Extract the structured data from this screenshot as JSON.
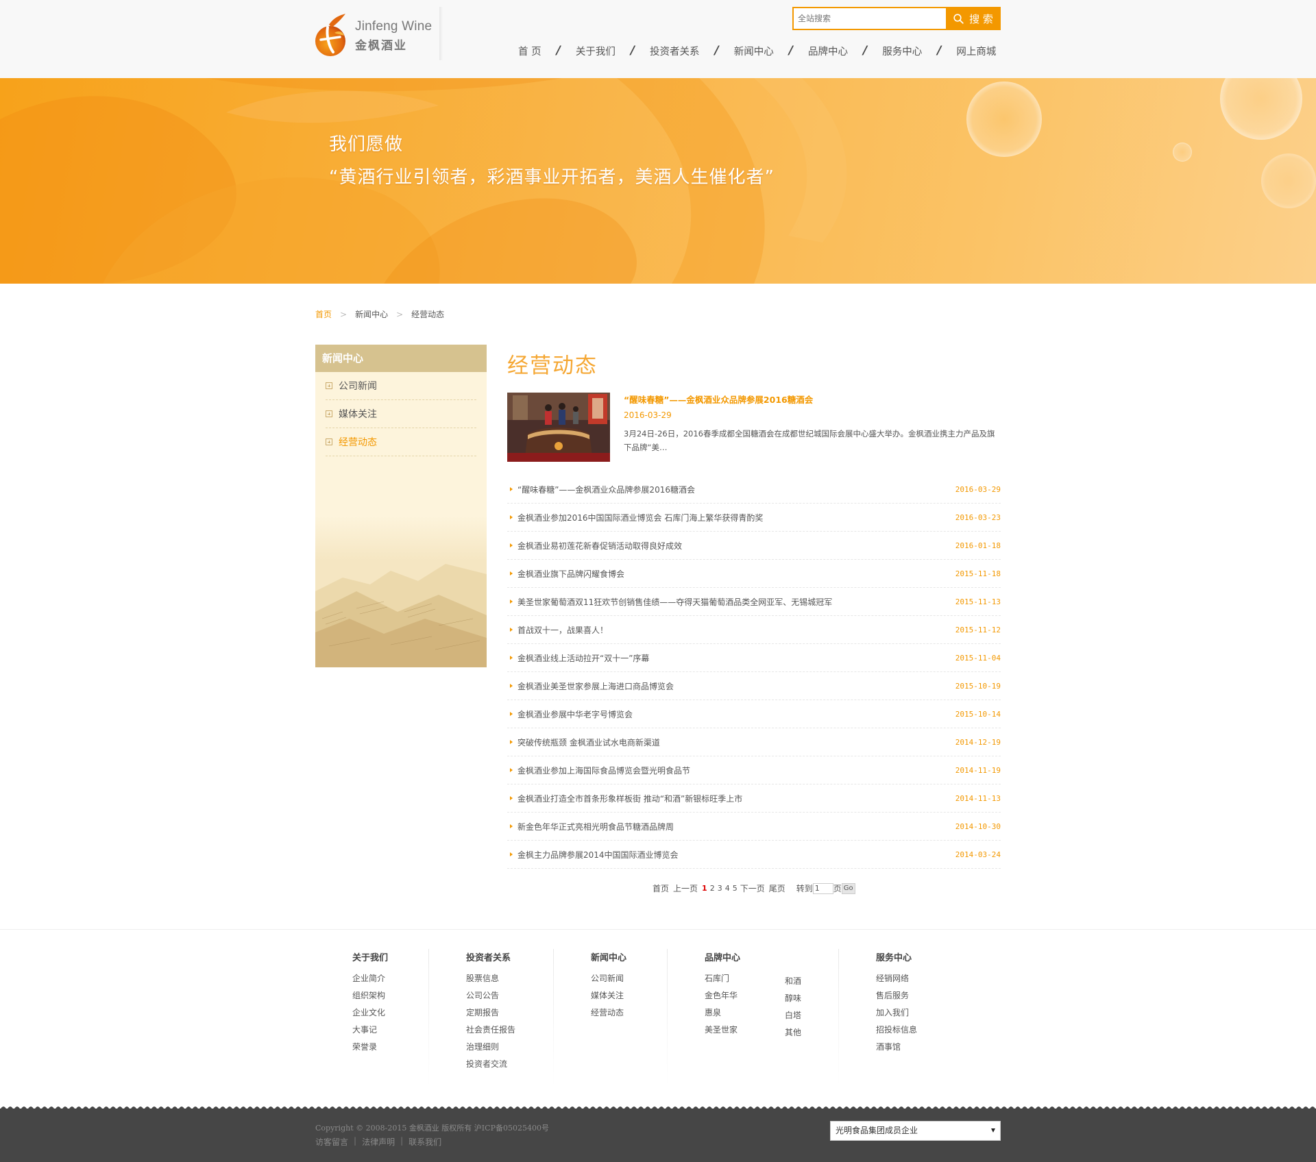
{
  "logo": {
    "en": "Jinfeng Wine",
    "cn": "金枫酒业"
  },
  "search": {
    "placeholder": "全站搜索",
    "button": "搜 索"
  },
  "nav": [
    "首 页",
    "关于我们",
    "投资者关系",
    "新闻中心",
    "品牌中心",
    "服务中心",
    "网上商城"
  ],
  "banner": {
    "line1": "我们愿做",
    "line2": "“黄酒行业引领者，彩酒事业开拓者，美酒人生催化者”"
  },
  "breadcrumb": [
    "首页",
    "新闻中心",
    "经营动态"
  ],
  "sidebar": {
    "title": "新闻中心",
    "items": [
      {
        "label": "公司新闻",
        "active": false
      },
      {
        "label": "媒体关注",
        "active": false
      },
      {
        "label": "经营动态",
        "active": true
      }
    ]
  },
  "main": {
    "title": "经营动态",
    "feature": {
      "title": "“醒味春糖”——金枫酒业众品牌参展2016糖酒会",
      "date": "2016-03-29",
      "summary": "3月24日-26日，2016春季成都全国糖酒会在成都世纪城国际会展中心盛大举办。金枫酒业携主力产品及旗下品牌“美…"
    },
    "news": [
      {
        "title": "“醒味春糖”——金枫酒业众品牌参展2016糖酒会",
        "date": "2016-03-29"
      },
      {
        "title": "金枫酒业参加2016中国国际酒业博览会 石库门海上繁华获得青酌奖",
        "date": "2016-03-23"
      },
      {
        "title": "金枫酒业易初莲花新春促销活动取得良好成效",
        "date": "2016-01-18"
      },
      {
        "title": "金枫酒业旗下品牌闪耀食博会",
        "date": "2015-11-18"
      },
      {
        "title": "美圣世家葡萄酒双11狂欢节创销售佳绩——夺得天猫葡萄酒品类全网亚军、无锡城冠军",
        "date": "2015-11-13"
      },
      {
        "title": "首战双十一，战果喜人！",
        "date": "2015-11-12"
      },
      {
        "title": "金枫酒业线上活动拉开“双十一”序幕",
        "date": "2015-11-04"
      },
      {
        "title": "金枫酒业美圣世家参展上海进口商品博览会",
        "date": "2015-10-19"
      },
      {
        "title": "金枫酒业参展中华老字号博览会",
        "date": "2015-10-14"
      },
      {
        "title": "突破传统瓶颈 金枫酒业试水电商新渠道",
        "date": "2014-12-19"
      },
      {
        "title": "金枫酒业参加上海国际食品博览会暨光明食品节",
        "date": "2014-11-19"
      },
      {
        "title": "金枫酒业打造全市首条形象样板街 推动“和酒”新银标旺季上市",
        "date": "2014-11-13"
      },
      {
        "title": "新金色年华正式亮相光明食品节糖酒品牌周",
        "date": "2014-10-30"
      },
      {
        "title": "金枫主力品牌参展2014中国国际酒业博览会",
        "date": "2014-03-24"
      }
    ]
  },
  "pager": {
    "first": "首页",
    "prev": "上一页",
    "pages": [
      "1",
      "2",
      "3",
      "4",
      "5"
    ],
    "current": "1",
    "next": "下一页",
    "last": "尾页",
    "goto_label": "转到",
    "goto_value": "1",
    "page_suffix": "页",
    "go": "Go"
  },
  "footer": {
    "cols": [
      {
        "title": "关于我们",
        "links": [
          "企业简介",
          "组织架构",
          "企业文化",
          "大事记",
          "荣誉录"
        ]
      },
      {
        "title": "投资者关系",
        "links": [
          "股票信息",
          "公司公告",
          "定期报告",
          "社会责任报告",
          "治理细则",
          "投资者交流"
        ]
      },
      {
        "title": "新闻中心",
        "links": [
          "公司新闻",
          "媒体关注",
          "经营动态"
        ]
      },
      {
        "title": "品牌中心",
        "links": [
          "石库门",
          "金色年华",
          "惠泉",
          "美圣世家"
        ],
        "links2": [
          "和酒",
          "醇味",
          "白塔",
          "其他"
        ]
      },
      {
        "title": "服务中心",
        "links": [
          "经销网络",
          "售后服务",
          "加入我们",
          "招投标信息",
          "酒事馆"
        ]
      }
    ],
    "copyright": "Copyright © 2008-2015 金枫酒业 版权所有 沪ICP备05025400号",
    "bottom_links": [
      "访客留言",
      "法律声明",
      "联系我们"
    ],
    "group_select": "光明食品集团成员企业"
  },
  "colors": {
    "accent": "#f39800",
    "sidebar_head": "#d6c28f",
    "footer_bg": "#464646"
  }
}
